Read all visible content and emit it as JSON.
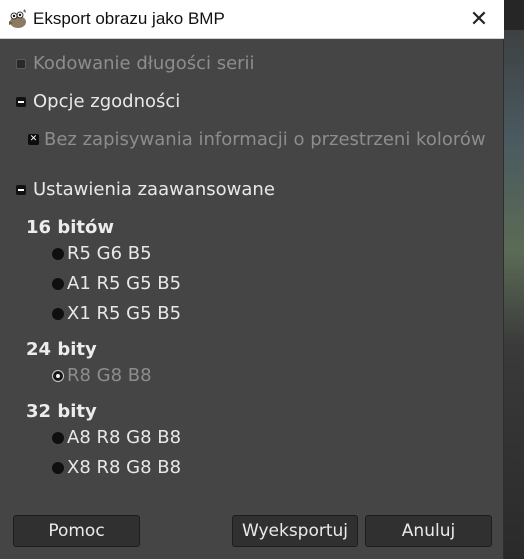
{
  "window": {
    "title": "Eksport obrazu jako BMP",
    "close_glyph": "✕",
    "app_icon": "gimp-wilber-icon"
  },
  "options": {
    "rle_label": "Kodowanie długości serii",
    "compat_label": "Opcje zgodności",
    "no_colorspace_label": "Bez zapisywania informacji o przestrzeni kolorów",
    "advanced_label": "Ustawienia zaawansowane"
  },
  "advanced": {
    "group16": {
      "title": "16 bitów",
      "items": [
        "R5 G6 B5",
        "A1 R5 G5 B5",
        "X1 R5 G5 B5"
      ]
    },
    "group24": {
      "title": "24 bity",
      "items": [
        "R8 G8 B8"
      ],
      "selected": "R8 G8 B8"
    },
    "group32": {
      "title": "32 bity",
      "items": [
        "A8 R8 G8 B8",
        "X8 R8 G8 B8"
      ]
    }
  },
  "buttons": {
    "help": "Pomoc",
    "export": "Wyeksportuj",
    "cancel": "Anuluj"
  },
  "colors": {
    "dialog_bg": "#454545",
    "titlebar_bg": "#ffffff",
    "text": "#e8e8e8",
    "muted_text": "#8d8d8d"
  }
}
